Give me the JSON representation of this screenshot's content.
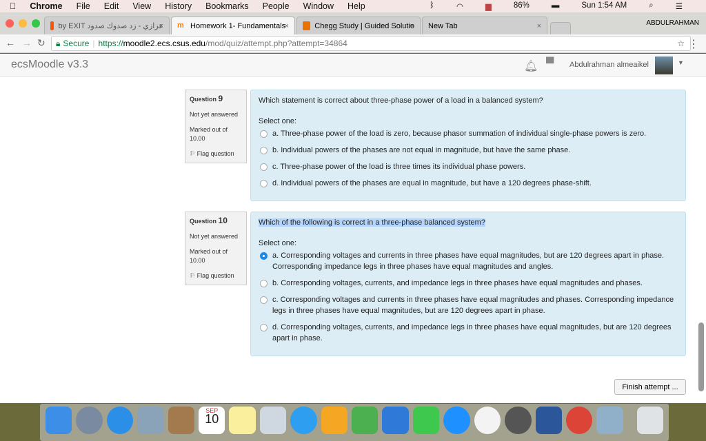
{
  "menubar": {
    "apple": "",
    "items": [
      "Chrome",
      "File",
      "Edit",
      "View",
      "History",
      "Bookmarks",
      "People",
      "Window",
      "Help"
    ],
    "battery": "86%",
    "clock": "Sun 1:54 AM"
  },
  "tabs": [
    {
      "label": "by EXIT عزازي - زد صدوك صدود",
      "favicon": "#ff5500"
    },
    {
      "label": "Homework 1- Fundamentals",
      "favicon": "#f98012"
    },
    {
      "label": "Chegg Study | Guided Solutio",
      "favicon": "#eb7100"
    },
    {
      "label": "New Tab",
      "favicon": ""
    }
  ],
  "profile": "ABDULRAHMAN",
  "address": {
    "secure": "Secure",
    "scheme": "https://",
    "host": "moodle2.ecs.csus.edu",
    "path": "/mod/quiz/attempt.php?attempt=34864"
  },
  "moodle": {
    "brand": "ecsMoodle v3.3",
    "user": "Abdulrahman almeaikel"
  },
  "questions": [
    {
      "label": "Question",
      "number": "9",
      "status": "Not yet answered",
      "marked": "Marked out of",
      "marks": "10.00",
      "flag": "Flag question",
      "text": "Which statement is correct about three-phase power of a load in a balanced system?",
      "select": "Select one:",
      "selected": -1,
      "options": [
        "a. Three-phase power of the load is zero, because phasor summation of individual single-phase powers is zero.",
        "b. Individual powers of the phases are not equal in magnitude, but have the same phase.",
        "c. Three-phase power of the load is three times its individual phase powers.",
        "d. Individual powers of the phases are equal in magnitude, but have a 120 degrees phase-shift."
      ]
    },
    {
      "label": "Question",
      "number": "10",
      "status": "Not yet answered",
      "marked": "Marked out of",
      "marks": "10.00",
      "flag": "Flag question",
      "text": "Which of the following is correct in a three-phase balanced system?",
      "select": "Select one:",
      "selected": 0,
      "options": [
        "a. Corresponding voltages and currents in three phases have equal magnitudes, but are 120 degrees apart in phase. Corresponding impedance legs in three phases have equal magnitudes and angles.",
        "b. Corresponding voltages, currents, and impedance legs in three phases have equal magnitudes and phases.",
        "c. Corresponding voltages and currents in three phases have equal magnitudes and phases. Corresponding impedance legs in three phases have equal magnitudes, but are 120 degrees apart in phase.",
        "d. Corresponding voltages, currents, and impedance legs in three phases have equal magnitudes, but are 120 degrees apart in phase."
      ]
    }
  ],
  "finish": "Finish attempt ...",
  "dock": {
    "calendar_month": "SEP",
    "calendar_day": "10"
  }
}
